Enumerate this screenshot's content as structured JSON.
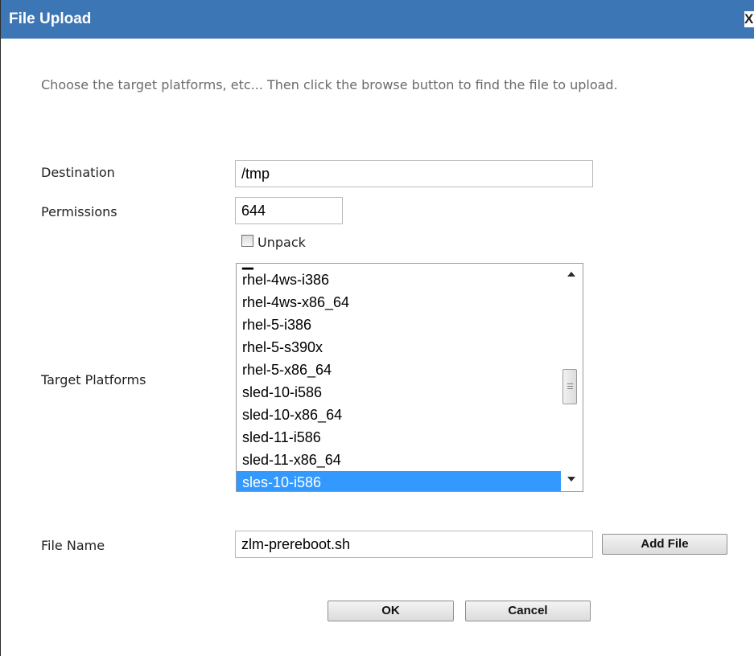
{
  "dialog": {
    "title": "File Upload",
    "close_label": "X"
  },
  "instructions": "Choose the target platforms, etc... Then click the browse button to find the file to upload.",
  "form": {
    "destination": {
      "label": "Destination",
      "value": "/tmp"
    },
    "permissions": {
      "label": "Permissions",
      "value": "644"
    },
    "unpack": {
      "label": "Unpack",
      "checked": false
    },
    "target_platforms": {
      "label": "Target Platforms",
      "items": [
        "rhel-4ws-i386",
        "rhel-4ws-x86_64",
        "rhel-5-i386",
        "rhel-5-s390x",
        "rhel-5-x86_64",
        "sled-10-i586",
        "sled-10-x86_64",
        "sled-11-i586",
        "sled-11-x86_64",
        "sles-10-i586"
      ],
      "selected": "sles-10-i586"
    },
    "file_name": {
      "label": "File Name",
      "value": "zlm-prereboot.sh"
    },
    "add_file_label": "Add File"
  },
  "buttons": {
    "ok_label": "OK",
    "cancel_label": "Cancel"
  },
  "colors": {
    "titlebar": "#3d76b4",
    "selection": "#3399ff"
  }
}
